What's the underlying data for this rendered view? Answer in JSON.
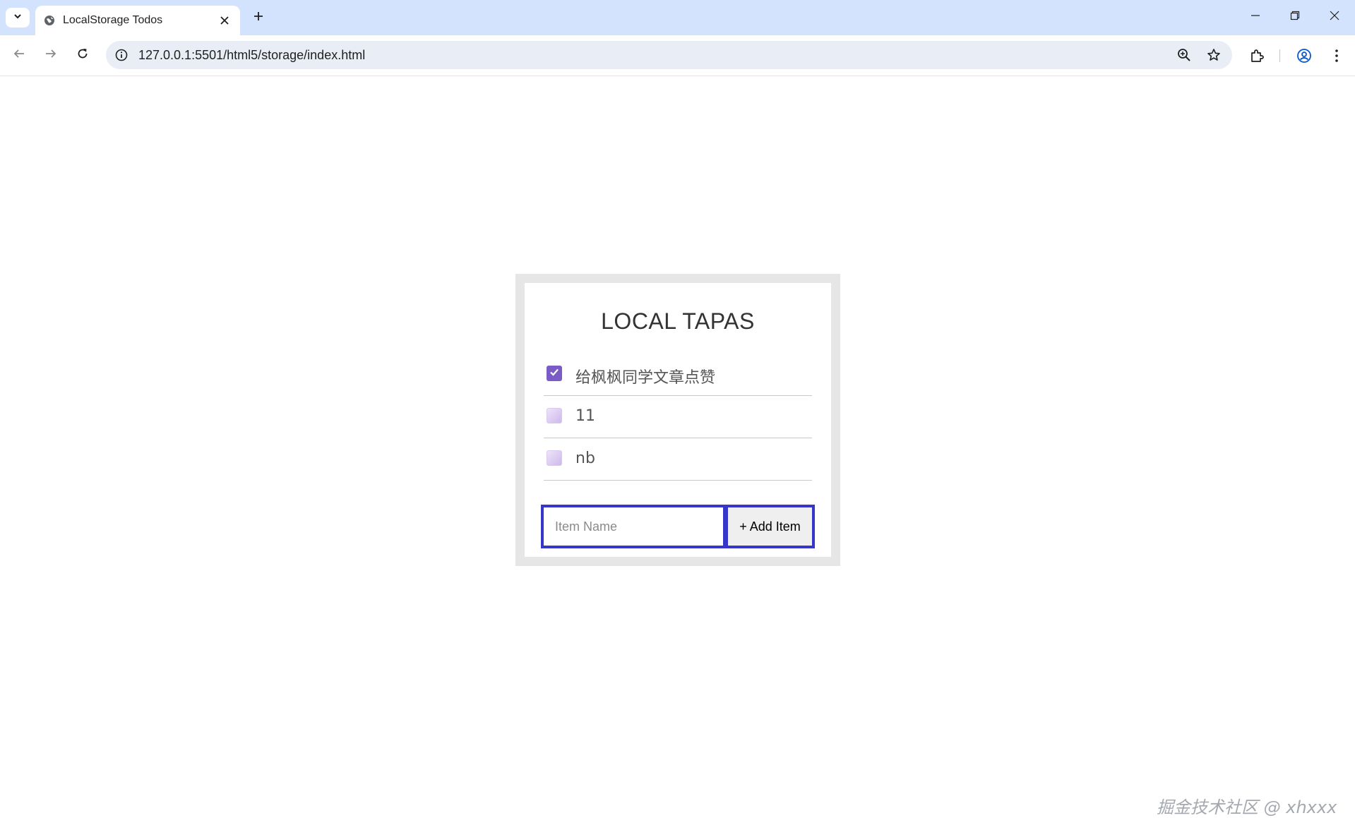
{
  "browser": {
    "tab_title": "LocalStorage Todos",
    "url": "127.0.0.1:5501/html5/storage/index.html"
  },
  "app": {
    "title": "LOCAL TAPAS",
    "items": [
      {
        "label": "给枫枫同学文章点赞",
        "done": true
      },
      {
        "label": "11",
        "done": false
      },
      {
        "label": "nb",
        "done": false
      }
    ],
    "input_placeholder": "Item Name",
    "add_button_label": "+ Add Item"
  },
  "watermark": "掘金技术社区 @ xhxxx",
  "colors": {
    "tabstrip": "#d3e3fd",
    "checkbox_checked": "#7b5cc6",
    "form_border": "#3636c9",
    "wrapper_border": "#e6e6e6"
  },
  "icons": {
    "tab_search": "chevron-down-icon",
    "favicon": "globe-icon",
    "close_tab": "close-icon",
    "new_tab": "plus-icon",
    "back": "arrow-left-icon",
    "forward": "arrow-right-icon",
    "reload": "reload-icon",
    "site_info": "info-icon",
    "zoom": "zoom-icon",
    "bookmark": "star-icon",
    "extensions": "puzzle-icon",
    "profile": "profile-icon",
    "menu": "kebab-menu-icon"
  }
}
